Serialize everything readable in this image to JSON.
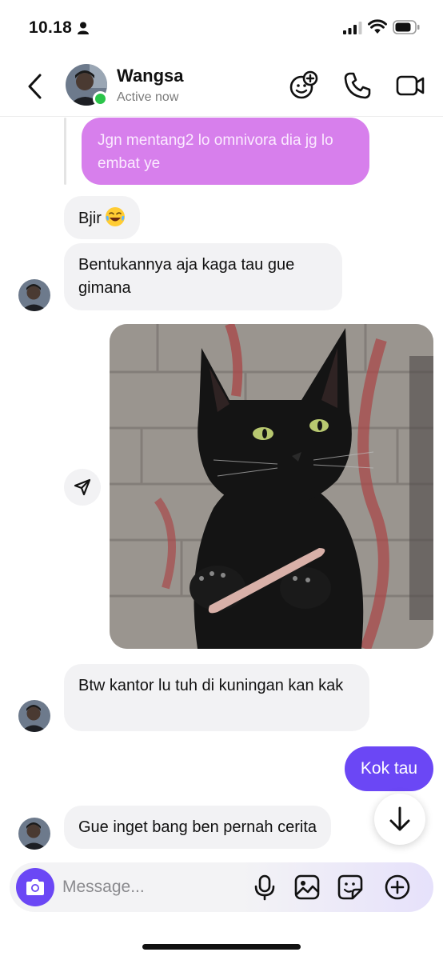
{
  "status_bar": {
    "time": "10.18"
  },
  "header": {
    "contact_name": "Wangsa",
    "contact_status": "Active now"
  },
  "messages": {
    "quoted_reply": "Jgn mentang2 lo omnivora dia jg lo embat ye",
    "bjir": "Bjir",
    "bentukannya": "Bentukannya aja kaga tau gue gimana",
    "btw_kantor": "Btw kantor lu tuh di kuningan kan kak",
    "kok_tau": "Kok tau",
    "gue_inget": "Gue inget bang ben pernah cerita"
  },
  "composer": {
    "placeholder": "Message..."
  },
  "colors": {
    "accent": "#6b47f5",
    "quoted_bubble": "#d77fec",
    "incoming_bubble": "#f2f2f4",
    "online": "#2bc44a"
  },
  "icons": [
    "person-icon",
    "signal-icon",
    "wifi-icon",
    "battery-icon",
    "back-icon",
    "effects-icon",
    "call-icon",
    "video-icon",
    "share-icon",
    "arrow-down-icon",
    "camera-icon",
    "mic-icon",
    "gallery-icon",
    "sticker-icon",
    "plus-icon"
  ]
}
